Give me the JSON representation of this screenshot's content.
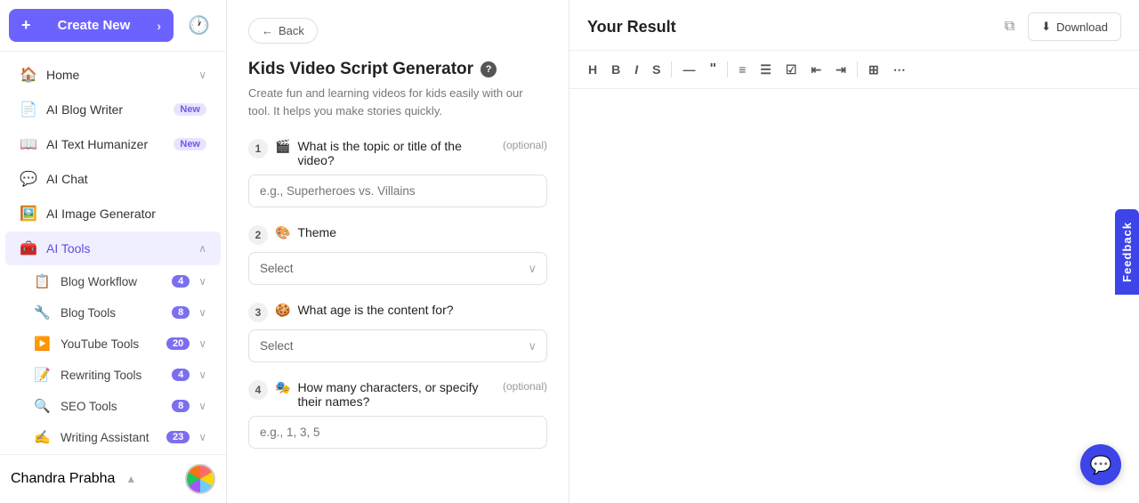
{
  "sidebar": {
    "create_new_label": "Create New",
    "history_icon": "🕐",
    "nav_items": [
      {
        "id": "home",
        "icon": "🏠",
        "label": "Home",
        "badge": null,
        "badge_type": null,
        "chevron": true
      },
      {
        "id": "ai-blog-writer",
        "icon": "📄",
        "label": "AI Blog Writer",
        "badge": "New",
        "badge_type": "new",
        "chevron": false
      },
      {
        "id": "ai-text-humanizer",
        "icon": "📖",
        "label": "AI Text Humanizer",
        "badge": "New",
        "badge_type": "new",
        "chevron": false
      },
      {
        "id": "ai-chat",
        "icon": "💬",
        "label": "AI Chat",
        "badge": null,
        "badge_type": null,
        "chevron": false
      },
      {
        "id": "ai-image-generator",
        "icon": "🖼️",
        "label": "AI Image Generator",
        "badge": null,
        "badge_type": null,
        "chevron": false
      },
      {
        "id": "ai-tools",
        "icon": "🧰",
        "label": "AI Tools",
        "badge": null,
        "badge_type": null,
        "chevron": true,
        "active": true
      }
    ],
    "sub_items": [
      {
        "id": "blog-workflow",
        "icon": "📋",
        "label": "Blog Workflow",
        "badge": "4"
      },
      {
        "id": "blog-tools",
        "icon": "🔧",
        "label": "Blog Tools",
        "badge": "8"
      },
      {
        "id": "youtube-tools",
        "icon": "▶️",
        "label": "YouTube Tools",
        "badge": "20"
      },
      {
        "id": "rewriting-tools",
        "icon": "📝",
        "label": "Rewriting Tools",
        "badge": "4"
      },
      {
        "id": "seo-tools",
        "icon": "🔍",
        "label": "SEO Tools",
        "badge": "8"
      },
      {
        "id": "writing-assistant",
        "icon": "✍️",
        "label": "Writing Assistant",
        "badge": "23"
      }
    ],
    "user": {
      "name": "Chandra Prabha",
      "chevron": "▲"
    }
  },
  "form": {
    "back_label": "Back",
    "title": "Kids Video Script Generator",
    "description": "Create fun and learning videos for kids easily with our tool. It helps you make stories quickly.",
    "questions": [
      {
        "number": "1",
        "emoji": "🎬",
        "text": "What is the topic or title of the video?",
        "optional": true,
        "type": "input",
        "placeholder": "e.g., Superheroes vs. Villains"
      },
      {
        "number": "2",
        "emoji": "🎨",
        "text": "Theme",
        "optional": false,
        "type": "select",
        "placeholder": "Select"
      },
      {
        "number": "3",
        "emoji": "🍪",
        "text": "What age is the content for?",
        "optional": false,
        "type": "select",
        "placeholder": "Select"
      },
      {
        "number": "4",
        "emoji": "🎭",
        "text": "How many characters, or specify their names?",
        "optional": true,
        "type": "input",
        "placeholder": "e.g., 1, 3, 5"
      }
    ]
  },
  "result": {
    "title": "Your Result",
    "copy_icon": "📋",
    "download_label": "Download",
    "toolbar": {
      "heading": "H",
      "bold": "B",
      "italic": "I",
      "strikethrough": "S",
      "divider1": "",
      "hr": "—",
      "quote": "❝",
      "bullet_list": "≡",
      "ordered_list": "#",
      "checklist": "☑",
      "indent_left": "⇤",
      "indent_right": "⇥",
      "divider2": "",
      "table": "⊞",
      "more": "⋯"
    }
  },
  "feedback": {
    "label": "Feedback"
  },
  "chat": {
    "icon": "💬"
  }
}
